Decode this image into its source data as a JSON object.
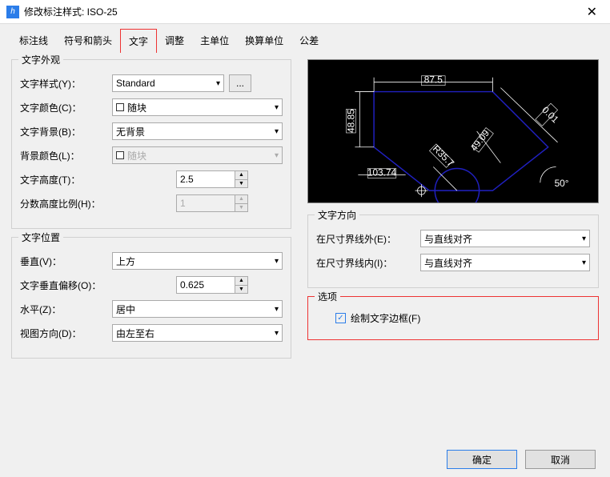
{
  "window": {
    "title": "修改标注样式: ISO-25"
  },
  "tabs": [
    "标注线",
    "符号和箭头",
    "文字",
    "调整",
    "主单位",
    "换算单位",
    "公差"
  ],
  "active_tab": "文字",
  "appearance": {
    "title": "文字外观",
    "style_label": "文字样式(Y)：",
    "style_value": "Standard",
    "ellipsis": "...",
    "color_label": "文字颜色(C)：",
    "color_value": "随块",
    "bg_label": "文字背景(B)：",
    "bg_value": "无背景",
    "bgcolor_label": "背景颜色(L)：",
    "bgcolor_value": "随块",
    "height_label": "文字高度(T)：",
    "height_value": "2.5",
    "frac_label": "分数高度比例(H)：",
    "frac_value": "1"
  },
  "position": {
    "title": "文字位置",
    "vert_label": "垂直(V)：",
    "vert_value": "上方",
    "offset_label": "文字垂直偏移(O)：",
    "offset_value": "0.625",
    "horiz_label": "水平(Z)：",
    "horiz_value": "居中",
    "viewdir_label": "视图方向(D)：",
    "viewdir_value": "由左至右"
  },
  "direction": {
    "title": "文字方向",
    "outside_label": "在尺寸界线外(E)：",
    "outside_value": "与直线对齐",
    "inside_label": "在尺寸界线内(I)：",
    "inside_value": "与直线对齐"
  },
  "options": {
    "title": "选项",
    "frame_label": "绘制文字边框(F)",
    "frame_checked": true
  },
  "footer": {
    "ok": "确定",
    "cancel": "取消"
  },
  "preview": {
    "dims": {
      "top": "87.5",
      "left": "48.85",
      "right": "0.01",
      "diag": "49.09",
      "radius": "R35.7",
      "bottom_arc": "Ø",
      "coord": "103.74",
      "angle": "50°"
    }
  }
}
